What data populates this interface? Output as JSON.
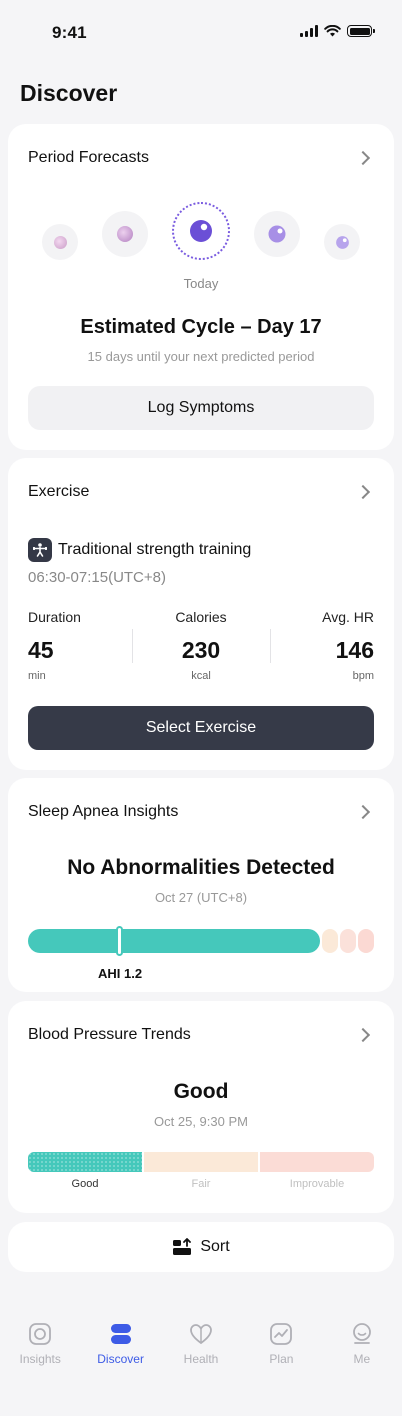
{
  "status_bar": {
    "time": "9:41"
  },
  "page_title": "Discover",
  "period": {
    "title": "Period Forecasts",
    "today_label": "Today",
    "cycle_title": "Estimated Cycle – Day 17",
    "cycle_subtitle": "15 days until your next predicted period",
    "button_label": "Log Symptoms"
  },
  "exercise": {
    "title": "Exercise",
    "name": "Traditional strength training",
    "time_range": "06:30-07:15(UTC+8)",
    "stats": [
      {
        "label": "Duration",
        "value": "45",
        "unit": "min"
      },
      {
        "label": "Calories",
        "value": "230",
        "unit": "kcal"
      },
      {
        "label": "Avg. HR",
        "value": "146",
        "unit": "bpm"
      }
    ],
    "button_label": "Select Exercise"
  },
  "sleep": {
    "title": "Sleep Apnea Insights",
    "status": "No Abnormalities Detected",
    "date": "Oct 27 (UTC+8)",
    "ahi_label": "AHI 1.2",
    "ahi_value": 1.2
  },
  "bp": {
    "title": "Blood Pressure Trends",
    "status": "Good",
    "date": "Oct 25, 9:30 PM",
    "segments": [
      "Good",
      "Fair",
      "Improvable"
    ],
    "active_segment": "Good"
  },
  "sort": {
    "label": "Sort"
  },
  "tabbar": {
    "tabs": [
      {
        "label": "Insights",
        "icon": "insights-icon"
      },
      {
        "label": "Discover",
        "icon": "discover-icon"
      },
      {
        "label": "Health",
        "icon": "health-icon"
      },
      {
        "label": "Plan",
        "icon": "plan-icon"
      },
      {
        "label": "Me",
        "icon": "me-icon"
      }
    ],
    "active": "Discover"
  },
  "colors": {
    "accent_blue": "#3d5be6",
    "teal": "#45c8bb",
    "dark_button": "#363a48",
    "moon_purple": "#7a5ce0"
  }
}
